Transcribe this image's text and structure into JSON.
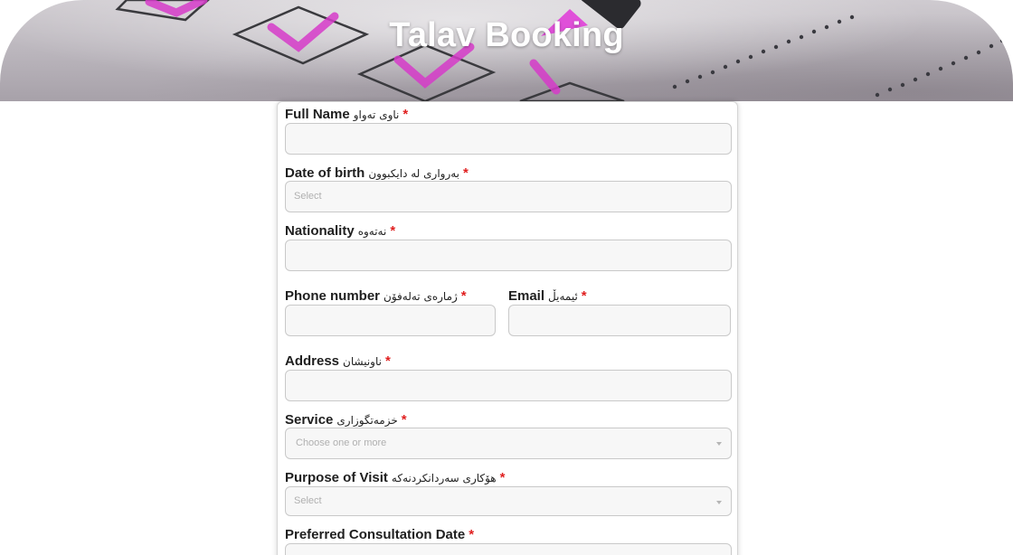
{
  "banner": {
    "title": "Talav Booking"
  },
  "form": {
    "full_name": {
      "label": "Full Name",
      "label_ku": "ناوی تەواو",
      "required_mark": "*",
      "value": ""
    },
    "date_of_birth": {
      "label": "Date of birth",
      "label_ku": "بەرواری لە دایکبوون",
      "required_mark": "*",
      "placeholder": "Select"
    },
    "nationality": {
      "label": "Nationality",
      "label_ku": "نەتەوە",
      "required_mark": "*",
      "value": ""
    },
    "phone": {
      "label": "Phone number",
      "label_ku": "ژمارەی تەلەفۆن",
      "required_mark": "*",
      "value": ""
    },
    "email": {
      "label": "Email",
      "label_ku": "ئیمەیڵ",
      "required_mark": "*",
      "value": ""
    },
    "address": {
      "label": "Address",
      "label_ku": "ناونیشان",
      "required_mark": "*",
      "value": ""
    },
    "service": {
      "label": "Service",
      "label_ku": "خزمەتگوزاری",
      "required_mark": "*",
      "placeholder": "Choose one or more"
    },
    "purpose": {
      "label": "Purpose of Visit",
      "label_ku": "هۆکاری سەردانکردنەکە",
      "required_mark": "*",
      "placeholder": "Select"
    },
    "consultation_date": {
      "label": "Preferred Consultation Date",
      "label_ku": "",
      "required_mark": "*"
    }
  },
  "colors": {
    "required": "#e02020",
    "accent_banner": "#d63bc9",
    "input_bg": "#f7f7f7"
  }
}
